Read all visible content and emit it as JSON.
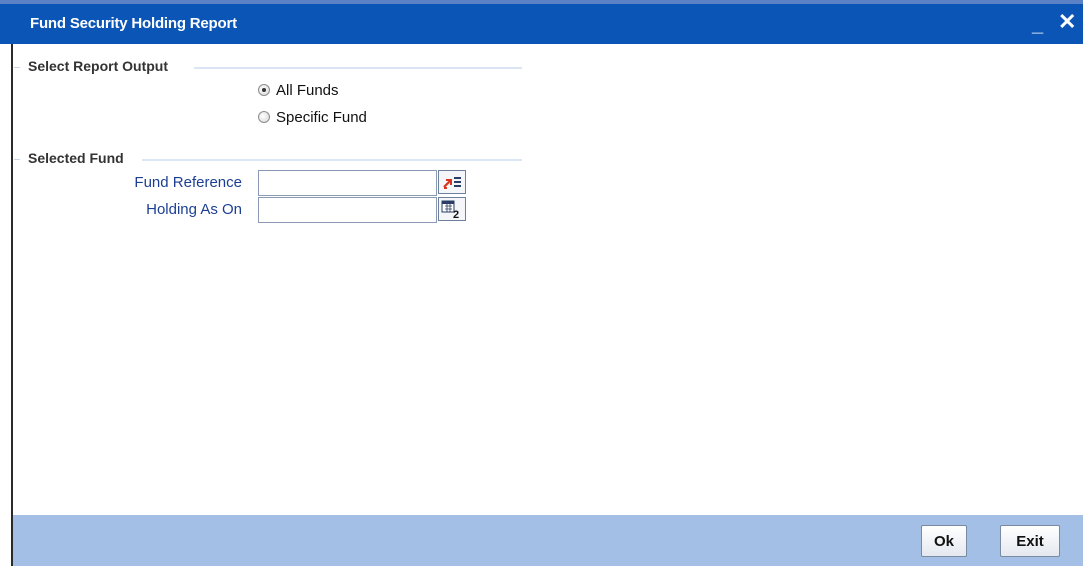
{
  "window": {
    "title": "Fund Security Holding Report",
    "minimize_symbol": "_",
    "close_symbol": "✕"
  },
  "report_output": {
    "legend": "Select Report Output",
    "options": [
      {
        "label": "All Funds",
        "checked": true
      },
      {
        "label": "Specific Fund",
        "checked": false
      }
    ]
  },
  "selected_fund": {
    "legend": "Selected Fund",
    "fund_reference_label": "Fund Reference",
    "fund_reference_value": "",
    "holding_as_on_label": "Holding As On",
    "holding_as_on_value": ""
  },
  "footer": {
    "ok_label": "Ok",
    "exit_label": "Exit"
  },
  "colors": {
    "title_bar": "#0b55b7",
    "footer": "#a3bfe5",
    "label_text": "#1c3f94"
  }
}
